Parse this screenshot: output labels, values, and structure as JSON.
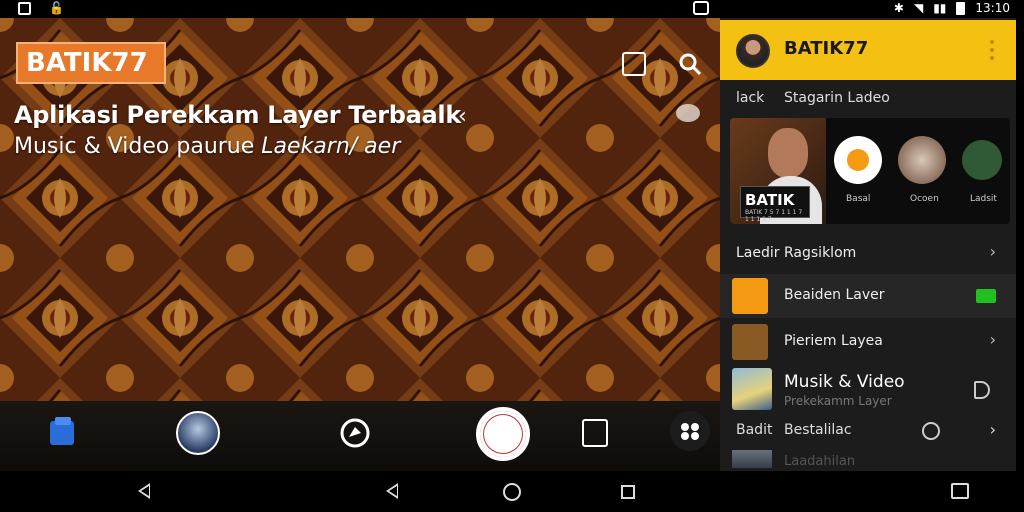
{
  "status_bar": {
    "time": "13:10"
  },
  "header": {
    "brand": "BATIK77",
    "headline": "Aplikasi Perekkam Layer Terbaalk",
    "subline_main": "Music & Video",
    "subline_extra": "paurue",
    "subline_italic": "Laekarn/ aer"
  },
  "drawer": {
    "title": "BATIK77",
    "section_label_a": "lack",
    "section_label_b": "Stagarin Ladeo",
    "media": {
      "logo": "BATIK",
      "logo_sub": "BATIK 7 5 7 1 1 1 7 1 1 1 1 7",
      "captions": [
        "Basal",
        "Ocoen",
        "Ladsit"
      ]
    },
    "items": [
      {
        "prefix": "Laedir",
        "label": "Ragsiklom"
      },
      {
        "label": "Beaiden Laver"
      },
      {
        "label": "Pieriem Layea"
      }
    ],
    "feature": {
      "title": "Musik & Video",
      "subtitle": "Prekekamm Layer"
    },
    "footer": {
      "a": "Badit",
      "b": "Bestalilac"
    },
    "ghost": "Laadahilan"
  },
  "colors": {
    "accent": "#f4c113",
    "brand_bg": "#e8782a",
    "drawer_bg": "#1c1c1c",
    "badge": "#21c021"
  }
}
